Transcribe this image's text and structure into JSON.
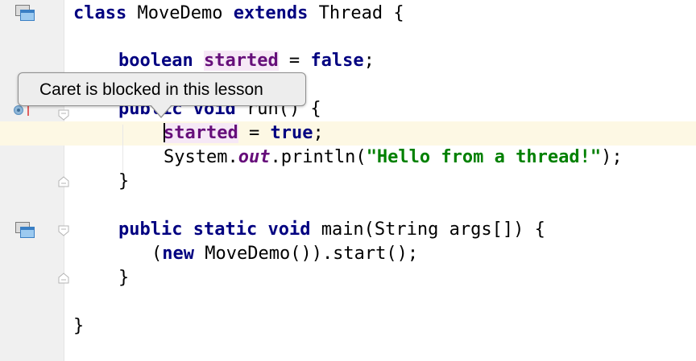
{
  "editor": {
    "lines": {
      "l1": {
        "kw_class": "class",
        "name": " MoveDemo ",
        "kw_extends": "extends",
        "rest": " Thread {"
      },
      "l2": {
        "kw_boolean": "boolean",
        "sp": " ",
        "field": "started",
        "eq": " = ",
        "kw_false": "false",
        "semi": ";"
      },
      "l3": {
        "kw_public": "public",
        "sp1": " ",
        "kw_void": "void",
        "rest": " run() {"
      },
      "l4": {
        "field": "started",
        "eq": " = ",
        "kw_true": "true",
        "semi": ";"
      },
      "l5": {
        "sys": "System.",
        "out": "out",
        "println": ".println(",
        "str": "\"Hello from a thread!\"",
        "end": ");"
      },
      "l6": {
        "brace": "}"
      },
      "l7": {
        "kw_public": "public",
        "kw_static": "static",
        "kw_void": "void",
        "rest": " main(String args[]) {"
      },
      "l8": {
        "open": "(",
        "kw_new": "new",
        "rest": " MoveDemo()).start();"
      },
      "l9": {
        "brace": "}"
      },
      "l10": {
        "brace": "}"
      }
    }
  },
  "tooltip": {
    "text": "Caret is blocked in this lesson"
  },
  "icons": {
    "implements": "implementation-marker-icon",
    "fold": "fold-marker-icon",
    "breakpoint": "run-gutter-icon"
  },
  "colors": {
    "keyword": "#000080",
    "field": "#660e7a",
    "string": "#008000",
    "caret_line": "#fdf8e4",
    "gutter": "#f0f0f0",
    "tooltip_bg": "#ededed"
  }
}
